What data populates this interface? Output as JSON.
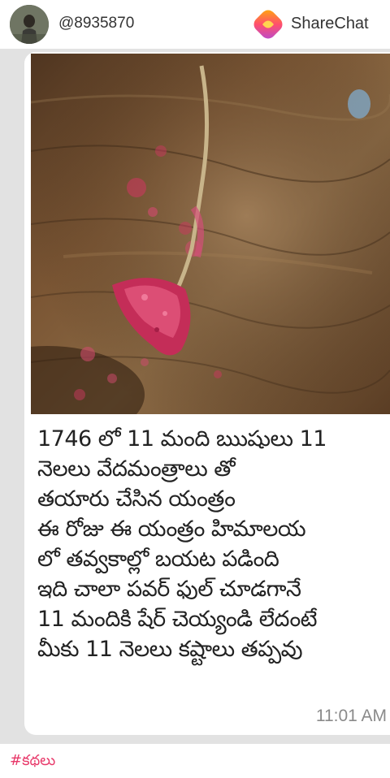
{
  "header": {
    "username": "@8935870",
    "brand_name": "ShareChat",
    "brand_logo_icon": "sharechat-logo-icon",
    "avatar_icon": "profile-avatar-icon"
  },
  "post": {
    "image_icon": "red-talisman-photo",
    "message": "1746 లో 11 మంది ఋషులు 11\nనెలలు వేదమంత్రాలు తో\nతయారు చేసిన యంత్రం\nఈ రోజు  ఈ యంత్రం హిమాలయ\nలో తవ్వకాల్లో బయట పడింది\n ఇది చాలా పవర్ ఫుల్ చూడగానే\n11 మందికి షేర్ చెయ్యండి లేదంటే\nమీకు 11 నెలలు కష్టాలు తప్పవు",
    "timestamp": "11:01 AM"
  },
  "footer": {
    "hashtag": "#కథలు"
  },
  "colors": {
    "hashtag": "#e8396a",
    "chat_background": "#e2e2e2",
    "bubble": "#ffffff"
  }
}
